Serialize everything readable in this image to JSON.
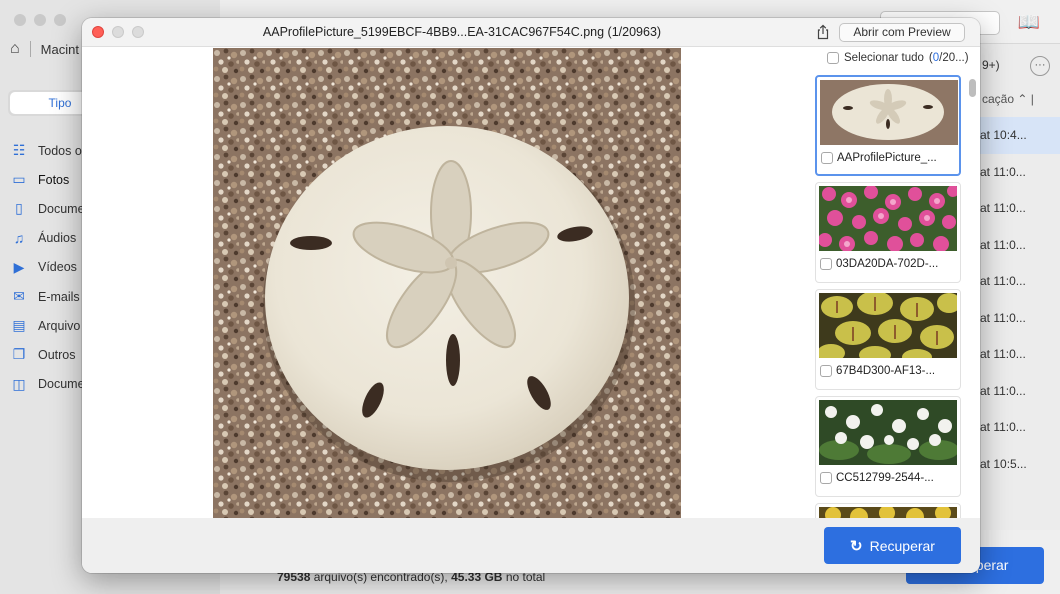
{
  "background_app": {
    "breadcrumb": {
      "volume": "Macint"
    },
    "sidebar": {
      "tab_active": "Tipo",
      "items": [
        {
          "label": "Todos o",
          "icon": "grid-list-icon"
        },
        {
          "label": "Fotos",
          "icon": "photo-icon"
        },
        {
          "label": "Docume",
          "icon": "document-icon"
        },
        {
          "label": "Áudios",
          "icon": "music-icon"
        },
        {
          "label": "Vídeos",
          "icon": "video-icon"
        },
        {
          "label": "E-mails",
          "icon": "mail-icon"
        },
        {
          "label": "Arquivo",
          "icon": "archive-icon"
        },
        {
          "label": "Outros",
          "icon": "other-files-icon"
        },
        {
          "label": "Docume",
          "icon": "document-alt-icon"
        }
      ]
    },
    "count_badge": "9+)",
    "column_header": "cação",
    "rows": [
      "at 10:4...",
      "at 11:0...",
      "at 11:0...",
      "at 11:0...",
      "at 11:0...",
      "at 11:0...",
      "at 11:0...",
      "at 11:0...",
      "at 11:0...",
      "at 10:5..."
    ],
    "footer": {
      "files_found_count": "79538",
      "files_found_text": " arquivo(s) encontrado(s), ",
      "total_size": "45.33 GB",
      "total_suffix": " no total"
    },
    "recover_button": "uperar"
  },
  "modal": {
    "title": "AAProfilePicture_5199EBCF-4BB9...EA-31CAC967F54C.png (1/20963)",
    "open_with_preview": "Abrir com Preview",
    "select_all": {
      "label": "Selecionar tudo",
      "open": "(",
      "count": "0",
      "rest": "/20...)"
    },
    "thumbnails": [
      {
        "name": "AAProfilePicture_...",
        "kind": "sand-dollar"
      },
      {
        "name": "03DA20DA-702D-...",
        "kind": "pink-flowers"
      },
      {
        "name": "67B4D300-AF13-...",
        "kind": "yellow-leaves"
      },
      {
        "name": "CC512799-2544-...",
        "kind": "white-flowers"
      },
      {
        "name": "",
        "kind": "yellow-flowers"
      }
    ],
    "recover_button": "Recuperar",
    "accent": "#2d6fe0"
  }
}
